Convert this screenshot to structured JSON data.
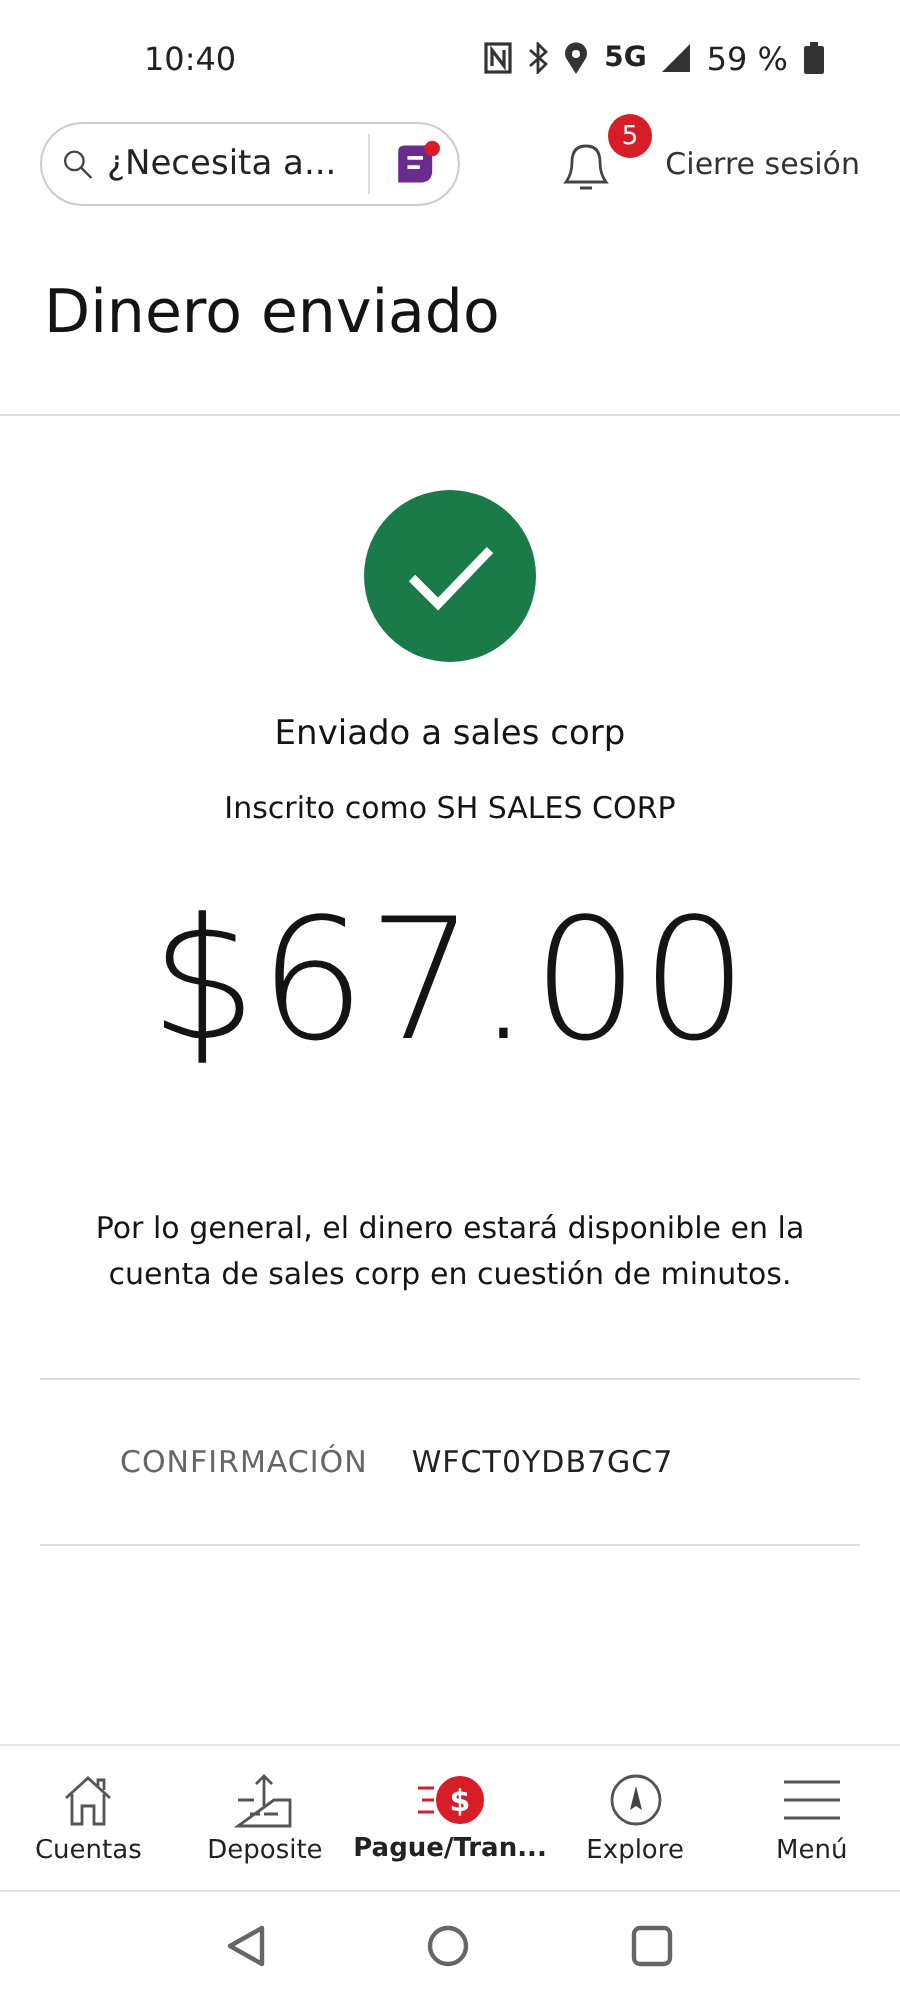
{
  "status_bar": {
    "time": "10:40",
    "network": "5G",
    "battery": "59 %"
  },
  "header": {
    "search": {
      "placeholder": "¿Necesita a..."
    },
    "chat_badge": true,
    "notifications": {
      "count": "5"
    },
    "logout": "Cierre sesión"
  },
  "page_title": "Dinero enviado",
  "result": {
    "recipient": "Enviado a sales corp",
    "enrolled_as": "Inscrito como SH SALES CORP",
    "amount": "$67.00",
    "note": "Por lo general, el dinero estará disponible en la cuenta de sales corp en cuestión de minutos.",
    "confirmation": {
      "label": "CONFIRMACIÓN",
      "value": "WFCT0YDB7GC7"
    }
  },
  "bottom_nav": [
    {
      "label": "Cuentas",
      "selected": false
    },
    {
      "label": "Deposite",
      "selected": false
    },
    {
      "label": "Pague/Tran...",
      "selected": true,
      "icon_glyph": "$"
    },
    {
      "label": "Explore",
      "selected": false
    },
    {
      "label": "Menú",
      "selected": false
    }
  ]
}
